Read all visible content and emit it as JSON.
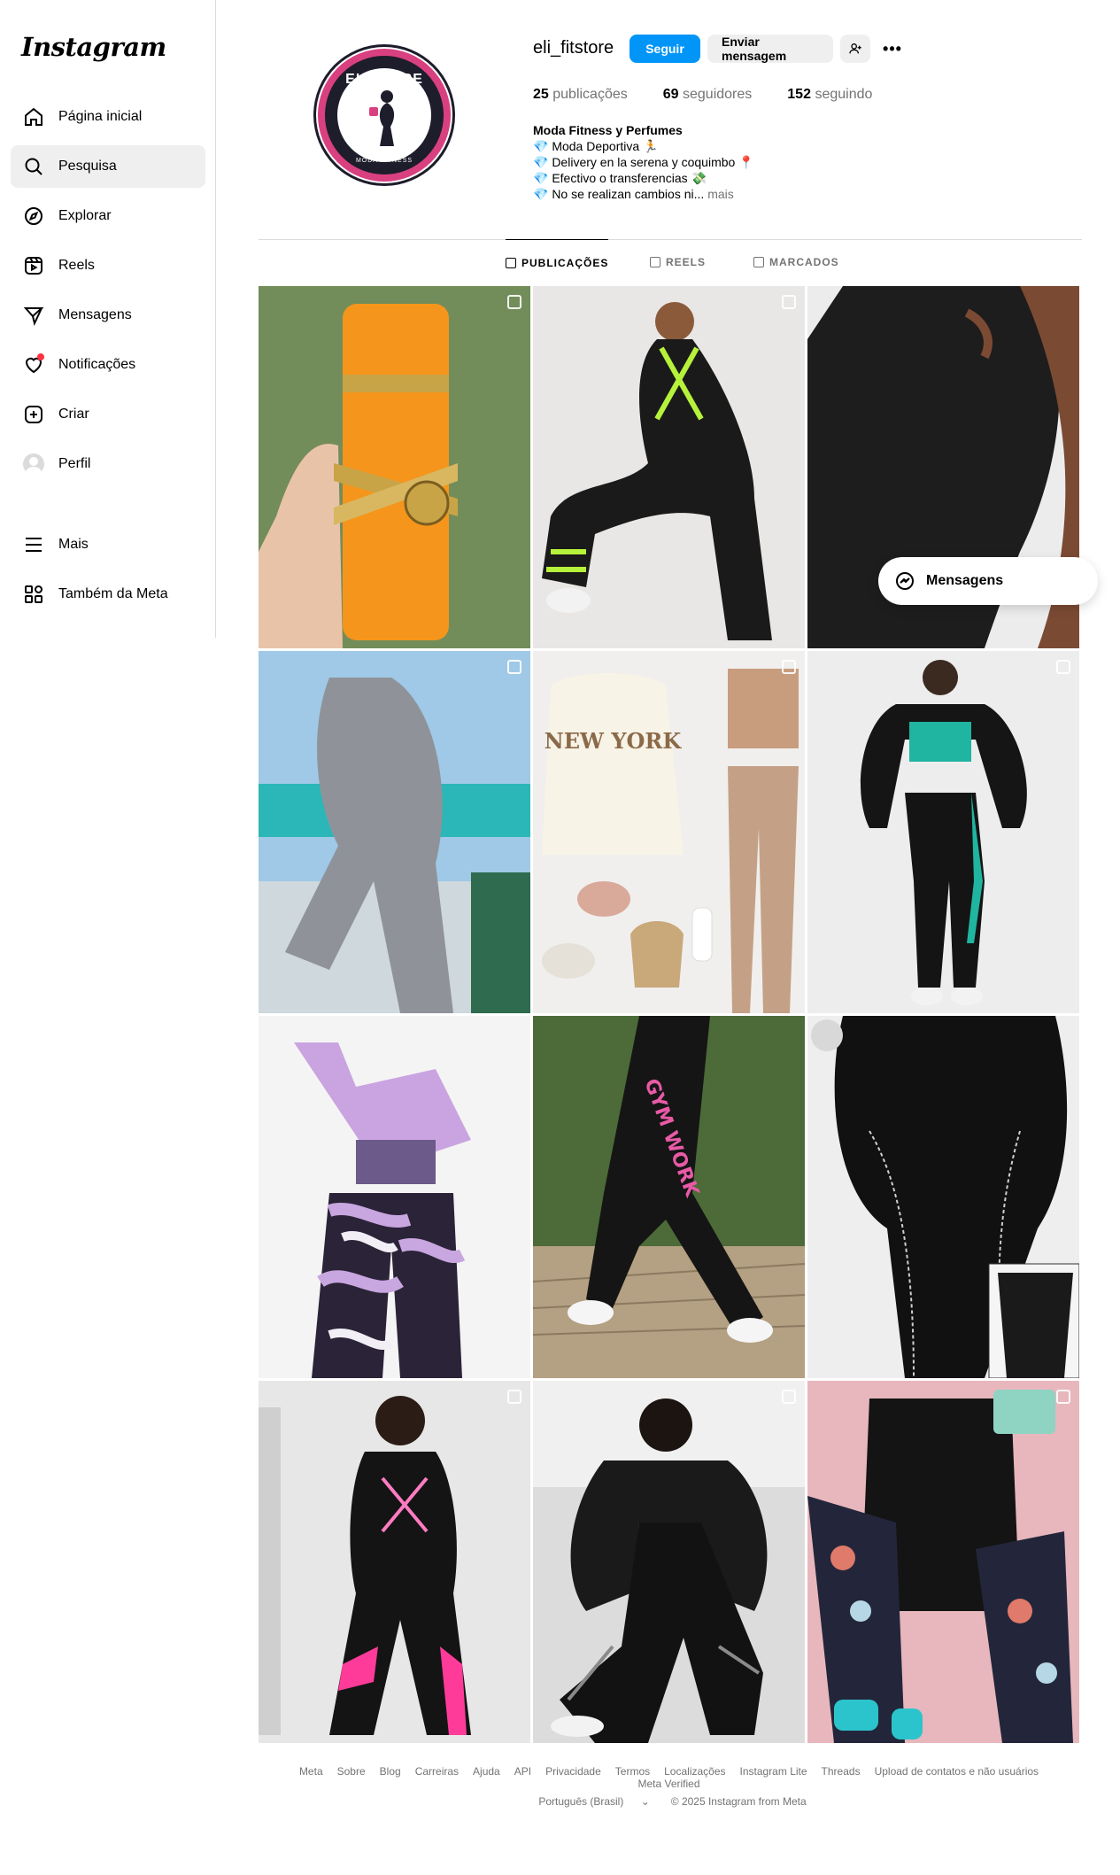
{
  "app": {
    "logo": "Instagram"
  },
  "sidebar": {
    "items": [
      {
        "label": "Página inicial",
        "icon": "home-icon"
      },
      {
        "label": "Pesquisa",
        "icon": "search-icon",
        "active": true
      },
      {
        "label": "Explorar",
        "icon": "compass-icon"
      },
      {
        "label": "Reels",
        "icon": "reels-icon"
      },
      {
        "label": "Mensagens",
        "icon": "send-icon"
      },
      {
        "label": "Notificações",
        "icon": "heart-icon",
        "dot": true
      },
      {
        "label": "Criar",
        "icon": "plus-square-icon"
      },
      {
        "label": "Perfil",
        "icon": "avatar"
      }
    ],
    "bottom": [
      {
        "label": "Mais",
        "icon": "menu-icon"
      },
      {
        "label": "Também da Meta",
        "icon": "meta-apps-icon"
      }
    ]
  },
  "profile": {
    "username": "eli_fitstore",
    "follow_label": "Seguir",
    "message_label": "Enviar mensagem",
    "more_label": "•••",
    "avatar_brand": "ELISTORE",
    "avatar_sub": "MODA FITNESS",
    "stats": {
      "posts_count": "25",
      "posts_label": "publicações",
      "followers_count": "69",
      "followers_label": "seguidores",
      "following_count": "152",
      "following_label": "seguindo"
    },
    "bio": {
      "name": "Moda Fitness y Perfumes",
      "line1": "💎 Moda Deportiva 🏃",
      "line2": "💎 Delivery en la serena y coquimbo 📍",
      "line3": "💎 Efectivo o transferencias 💸",
      "line4": "💎 No se realizan cambios ni...",
      "more": "mais"
    },
    "accent_color": "#0095f6"
  },
  "tabs": [
    {
      "label": "PUBLICAÇÕES",
      "active": true
    },
    {
      "label": "REELS",
      "active": false
    },
    {
      "label": "MARCADOS",
      "active": false
    }
  ],
  "posts": [
    {
      "alt": "orange perfume bottle"
    },
    {
      "alt": "black jumpsuit with neon straps"
    },
    {
      "alt": "black textured jumpsuit"
    },
    {
      "alt": "grey textured jumpsuit"
    },
    {
      "alt": "NEW YORK hoodie set",
      "text": "NEW YORK"
    },
    {
      "alt": "black and teal set"
    },
    {
      "alt": "lilac camo set"
    },
    {
      "alt": "GYM WORK leggings",
      "text": "GYM WORK"
    },
    {
      "alt": "black leggings"
    },
    {
      "alt": "black leggings with pink"
    },
    {
      "alt": "black mesh set"
    },
    {
      "alt": "floral set with accessories"
    }
  ],
  "floating_messages": {
    "label": "Mensagens"
  },
  "footer": {
    "links": [
      "Meta",
      "Sobre",
      "Blog",
      "Carreiras",
      "Ajuda",
      "API",
      "Privacidade",
      "Termos",
      "Localizações",
      "Instagram Lite",
      "Threads",
      "Upload de contatos e não usuários",
      "Meta Verified"
    ],
    "language": "Português (Brasil)",
    "copyright": "© 2025 Instagram from Meta"
  }
}
